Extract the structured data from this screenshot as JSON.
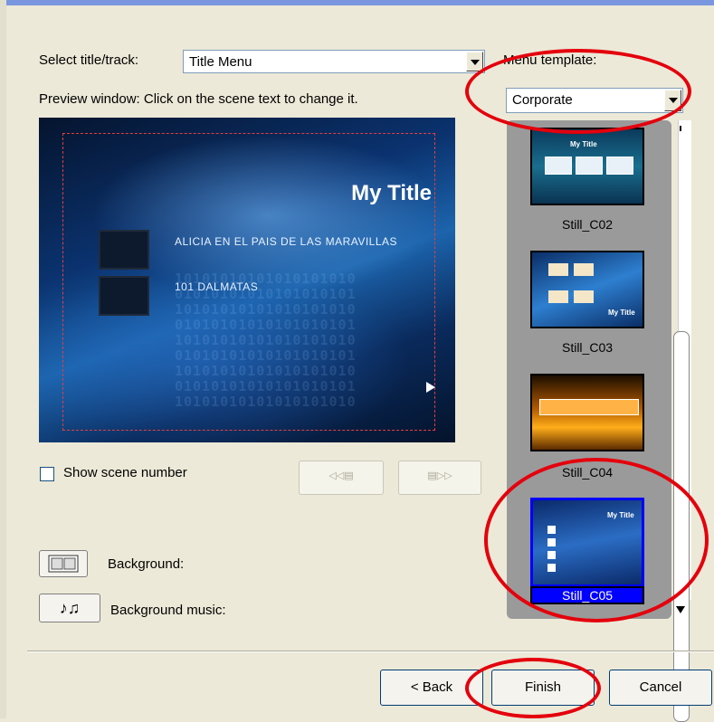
{
  "labels": {
    "select_title_track": "Select title/track:",
    "menu_template": "Menu template:",
    "preview_hint": "Preview window: Click on the scene text to change it.",
    "show_scene_number": "Show scene number",
    "background": "Background:",
    "background_music": "Background music:"
  },
  "title_track": {
    "selected": "Title Menu"
  },
  "menu_template": {
    "selected": "Corporate"
  },
  "preview": {
    "title": "My Title",
    "scenes": [
      "ALICIA EN EL PAIS DE LAS MARAVILLAS",
      "101 DALMATAS"
    ]
  },
  "templates": [
    {
      "name": "Still_C02",
      "selected": false
    },
    {
      "name": "Still_C03",
      "selected": false
    },
    {
      "name": "Still_C04",
      "selected": false
    },
    {
      "name": "Still_C05",
      "selected": true
    }
  ],
  "thumbnail_titles": {
    "c02": "My Title",
    "c03": "My Title",
    "c05": "My Title"
  },
  "buttons": {
    "back": "< Back",
    "finish": "Finish",
    "cancel": "Cancel"
  },
  "colors": {
    "highlight_circle": "#e4000c",
    "selection": "#0000ff",
    "window_bg": "#ece9d8"
  }
}
